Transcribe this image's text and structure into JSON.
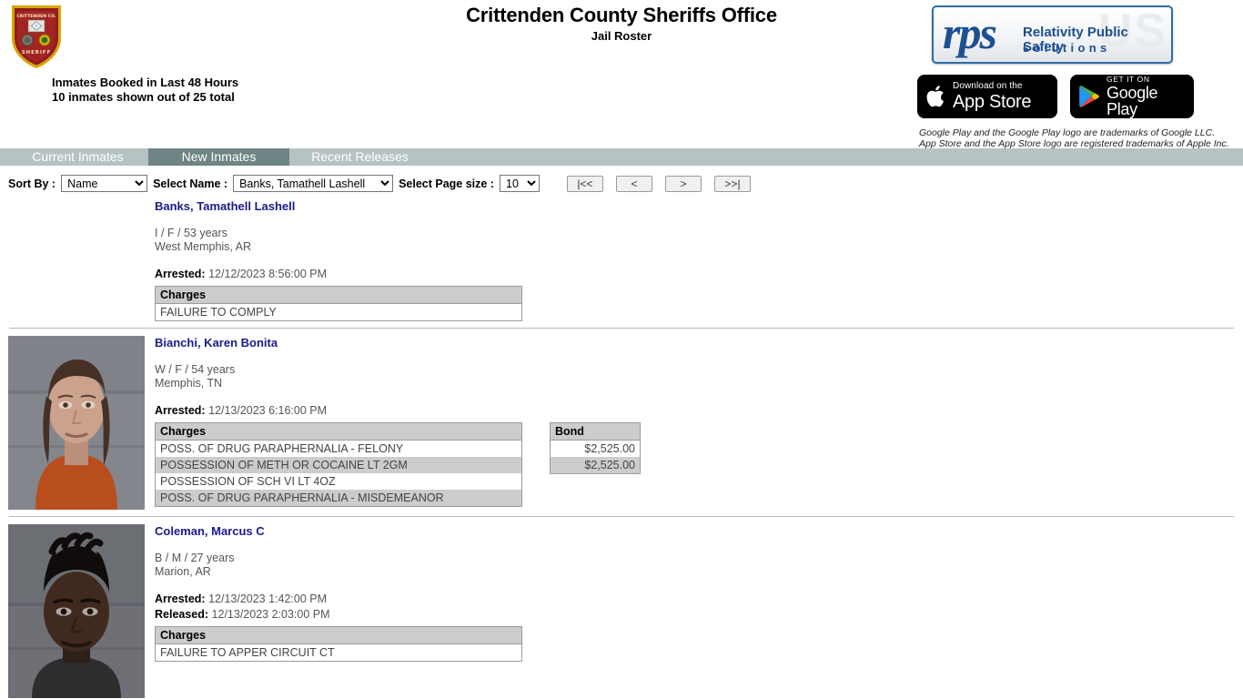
{
  "header": {
    "title": "Crittenden County Sheriffs Office",
    "subtitle": "Jail Roster",
    "booked_line1": "Inmates Booked in Last 48 Hours",
    "booked_line2": "10 inmates shown out of 25 total",
    "badge_top_text": "CRITTENDEN CO.",
    "badge_bottom_text": "SHERIFF"
  },
  "branding": {
    "rps_mark": "rps",
    "rps_ghost": "US",
    "rps_tagline1": "Relativity Public Safety",
    "rps_tagline2": "solutions",
    "app_store": {
      "small": "Download on the",
      "big": "App Store"
    },
    "google_play": {
      "small": "GET IT ON",
      "big": "Google Play"
    },
    "legal_line1": "Google Play and the Google Play logo are trademarks of Google LLC.",
    "legal_line2": "App Store and the App Store logo are registered trademarks of Apple Inc."
  },
  "tabs": [
    {
      "label": "Current Inmates",
      "active": false
    },
    {
      "label": "New Inmates",
      "active": true
    },
    {
      "label": "Recent Releases",
      "active": false
    }
  ],
  "controls": {
    "sort_label": "Sort By :",
    "sort_value": "Name",
    "sort_options": [
      "Name"
    ],
    "name_label": "Select Name :",
    "name_value": "Banks, Tamathell Lashell",
    "name_options": [
      "Banks, Tamathell Lashell"
    ],
    "pagesize_label": "Select Page size :",
    "pagesize_value": "10",
    "pagesize_options": [
      "10"
    ],
    "pager": [
      {
        "label": "|<<",
        "name": "first-page-button"
      },
      {
        "label": "<",
        "name": "prev-page-button"
      },
      {
        "label": ">",
        "name": "next-page-button"
      },
      {
        "label": ">>|",
        "name": "last-page-button"
      }
    ]
  },
  "labels": {
    "arrested": "Arrested:",
    "released": "Released:",
    "charges_header": "Charges",
    "bond_header": "Bond"
  },
  "records": [
    {
      "name": "Banks, Tamathell Lashell",
      "demographics": "I / F / 53 years",
      "city": "West Memphis, AR",
      "arrested": "12/12/2023 8:56:00 PM",
      "released": "",
      "has_photo": false,
      "charges": [
        "FAILURE TO COMPLY"
      ],
      "bond": []
    },
    {
      "name": "Bianchi, Karen Bonita",
      "demographics": "W / F / 54 years",
      "city": "Memphis, TN",
      "arrested": "12/13/2023 6:16:00 PM",
      "released": "",
      "has_photo": true,
      "charges": [
        "POSS. OF DRUG PARAPHERNALIA - FELONY",
        "POSSESSION OF METH OR COCAINE LT 2GM",
        "POSSESSION OF SCH VI LT 4OZ",
        "POSS. OF DRUG PARAPHERNALIA - MISDEMEANOR"
      ],
      "bond": [
        "$2,525.00",
        "$2,525.00"
      ]
    },
    {
      "name": "Coleman, Marcus C",
      "demographics": "B / M / 27 years",
      "city": "Marion, AR",
      "arrested": "12/13/2023 1:42:00 PM",
      "released": "12/13/2023 2:03:00 PM",
      "has_photo": true,
      "charges": [
        "FAILURE TO APPER CIRCUIT CT"
      ],
      "bond": []
    }
  ],
  "colors": {
    "tabbar_bg": "#b6c3c3",
    "tab_active_bg": "#6e8485",
    "link": "#1a1a8c",
    "table_header_bg": "#cccccc",
    "rps_blue": "#1d4f91"
  }
}
